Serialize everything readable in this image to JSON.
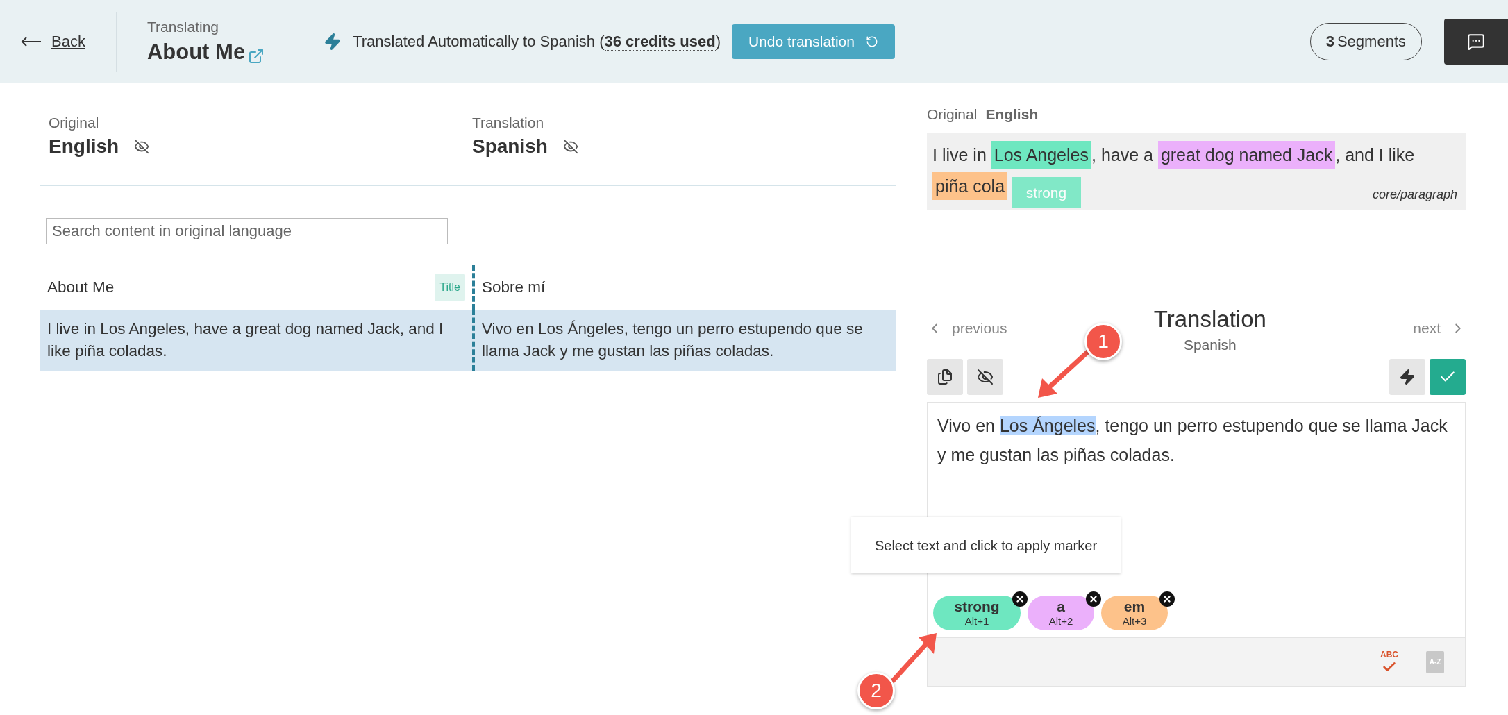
{
  "header": {
    "back": "Back",
    "context_label": "Translating",
    "page_title": "About Me",
    "status": "Translated Automatically to Spanish (**36 credits used**)",
    "undo_button": "Undo translation",
    "segments_count": "3",
    "segments_label": "Segments"
  },
  "languages": [
    {
      "label": "Original",
      "language": "English"
    },
    {
      "label": "Translation",
      "language": "Spanish"
    }
  ],
  "search": {
    "placeholder": "Search content in original language"
  },
  "segments": [
    {
      "original": "About Me",
      "tag": "Title",
      "translation": "Sobre mí",
      "selected": false
    },
    {
      "original": "I live in Los Angeles, have a great dog named Jack, and I like piña coladas.",
      "translation": "Vivo en Los Ángeles, tengo un perro estupendo que se llama Jack y me gustan las piñas coladas.",
      "selected": true
    }
  ],
  "preview": {
    "label": "Original",
    "language": "English",
    "parts": [
      {
        "text": "I live in "
      },
      {
        "text": "Los Angeles",
        "color": "#6ee7c0"
      },
      {
        "text": ", have a "
      },
      {
        "text": "great dog named Jack",
        "color": "#ebb0fb"
      },
      {
        "text": ", and I like "
      },
      {
        "text": "piña cola",
        "color": "#fdc28a"
      }
    ],
    "block_type": "core/paragraph",
    "tooltip": "strong"
  },
  "editor": {
    "previous": "previous",
    "title": "Translation",
    "language": "Spanish",
    "next": "next",
    "parts": [
      {
        "text": "Vivo en "
      },
      {
        "text": "Los Ángeles",
        "highlighted": true
      },
      {
        "text": ", tengo un perro estupendo que se llama Jack y me gustan las piñas coladas."
      }
    ],
    "hint": "Select text and click to apply marker",
    "spellcheck": "ABC",
    "glossary": "A-Z"
  },
  "markers": [
    {
      "name": "strong",
      "shortcut": "Alt+1",
      "color": "#6ee7c0"
    },
    {
      "name": "a",
      "shortcut": "Alt+2",
      "color": "#ebb0fb"
    },
    {
      "name": "em",
      "shortcut": "Alt+3",
      "color": "#fdc28a"
    }
  ],
  "callouts": [
    {
      "number": "1"
    },
    {
      "number": "2"
    }
  ]
}
